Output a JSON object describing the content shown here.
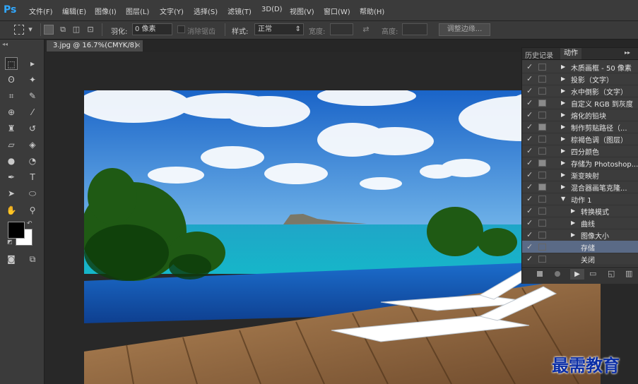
{
  "app": {
    "logo": "Ps"
  },
  "menu": [
    "文件(F)",
    "编辑(E)",
    "图像(I)",
    "图层(L)",
    "文字(Y)",
    "选择(S)",
    "滤镜(T)",
    "3D(D)",
    "视图(V)",
    "窗口(W)",
    "帮助(H)"
  ],
  "options": {
    "feather_label": "羽化:",
    "feather_value": "0 像素",
    "antialias_label": "消除锯齿",
    "style_label": "样式:",
    "style_value": "正常",
    "width_label": "宽度:",
    "height_label": "高度:",
    "refine_edge": "调整边缘..."
  },
  "document_tab": {
    "title": "3.jpg @ 16.7%(CMYK/8)",
    "close": "×"
  },
  "panel": {
    "tabs": [
      "历史记录",
      "动作"
    ],
    "menu_icon": "▸▸",
    "actions": [
      {
        "label": "木质画框 - 50 像素",
        "indent": 0,
        "expand": "collapsed",
        "dialog": false
      },
      {
        "label": "投影（文字）",
        "indent": 0,
        "expand": "collapsed",
        "dialog": false
      },
      {
        "label": "水中倒影（文字）",
        "indent": 0,
        "expand": "collapsed",
        "dialog": false
      },
      {
        "label": "自定义 RGB 到灰度",
        "indent": 0,
        "expand": "collapsed",
        "dialog": true
      },
      {
        "label": "熔化的铅块",
        "indent": 0,
        "expand": "collapsed",
        "dialog": false
      },
      {
        "label": "制作剪贴路径（...",
        "indent": 0,
        "expand": "collapsed",
        "dialog": true
      },
      {
        "label": "棕褐色调（图层）",
        "indent": 0,
        "expand": "collapsed",
        "dialog": false
      },
      {
        "label": "四分颜色",
        "indent": 0,
        "expand": "collapsed",
        "dialog": false
      },
      {
        "label": "存储为 Photoshop...",
        "indent": 0,
        "expand": "collapsed",
        "dialog": true
      },
      {
        "label": "渐变映射",
        "indent": 0,
        "expand": "collapsed",
        "dialog": false
      },
      {
        "label": "混合器画笔克隆...",
        "indent": 0,
        "expand": "collapsed",
        "dialog": true
      },
      {
        "label": "动作 1",
        "indent": 0,
        "expand": "expanded",
        "dialog": false
      },
      {
        "label": "转换模式",
        "indent": 1,
        "expand": "collapsed",
        "dialog": false
      },
      {
        "label": "曲线",
        "indent": 1,
        "expand": "collapsed",
        "dialog": false
      },
      {
        "label": "图像大小",
        "indent": 1,
        "expand": "collapsed",
        "dialog": false
      },
      {
        "label": "存储",
        "indent": 1,
        "expand": "none",
        "dialog": false,
        "selected": true
      },
      {
        "label": "关闭",
        "indent": 1,
        "expand": "none",
        "dialog": false
      }
    ],
    "bottom_icons": [
      "stop-icon",
      "record-icon",
      "play-icon",
      "folder-icon",
      "new-action-icon",
      "trash-icon"
    ]
  },
  "watermark": "最需教育",
  "colors": {
    "accent_ps": "#31a8ff",
    "panel_selected": "#5a6a86",
    "watermark": "#0b2ea6"
  }
}
